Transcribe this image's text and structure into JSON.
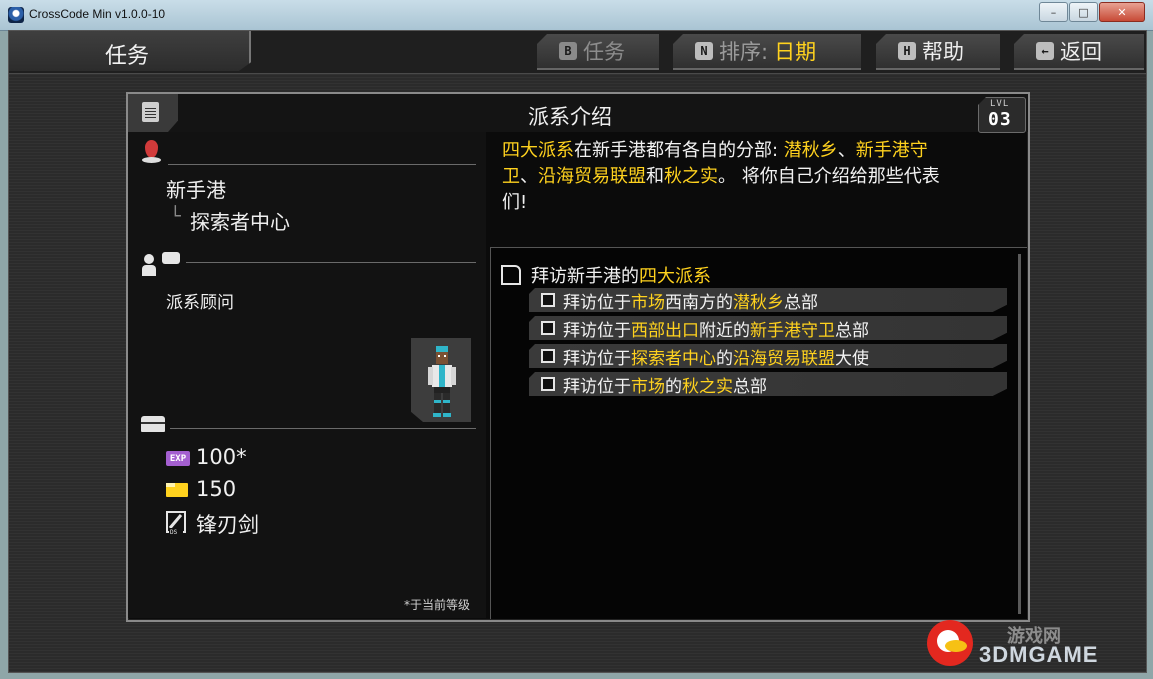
{
  "window": {
    "title": "CrossCode Min v1.0.0-10",
    "minimize": "–",
    "maximize": "□",
    "close": "✕"
  },
  "topbar": {
    "screen_title": "任务",
    "buttons": {
      "quests": {
        "key": "B",
        "label": "任务"
      },
      "sort": {
        "key": "N",
        "label": "排序:",
        "value": "日期"
      },
      "help": {
        "key": "H",
        "label": "帮助"
      },
      "back": {
        "key": "←",
        "label": "返回"
      }
    }
  },
  "quest": {
    "title": "派系介绍",
    "level_label": "LVL",
    "level": "03",
    "location": "新手港",
    "sub_location": "探索者中心",
    "sub_location_prefix": "└",
    "quest_giver": "派系顾问",
    "rewards": {
      "exp_icon_text": "EXP",
      "exp": "100*",
      "credits": "150",
      "item": "锋刃剑"
    },
    "footnote": "*于当前等级",
    "description": {
      "line1_a": "四大派系",
      "line1_b": "在新手港都有各自的分部: ",
      "line1_c": "潜秋乡",
      "line1_d": "、",
      "line1_e": "新手港守",
      "line2_a": "卫",
      "line2_b": "、",
      "line2_c": "沿海贸易联盟",
      "line2_d": "和",
      "line2_e": "秋之实",
      "line2_f": "。 将你自己介绍给那些代表",
      "line3": "们!"
    },
    "main_task": {
      "a": "拜访新手港的",
      "b": "四大派系"
    },
    "sub_tasks": [
      {
        "a": "拜访位于",
        "b": "市场",
        "c": "西南方的",
        "d": "潜秋乡",
        "e": "总部"
      },
      {
        "a": "拜访位于",
        "b": "西部出口",
        "c": "附近的",
        "d": "新手港守卫",
        "e": "总部"
      },
      {
        "a": "拜访位于",
        "b": "探索者中心",
        "c": "的",
        "d": "沿海贸易联盟",
        "e": "大使"
      },
      {
        "a": "拜访位于",
        "b": "市场",
        "c": "的",
        "d": "秋之实",
        "e": "总部"
      }
    ]
  },
  "watermark": {
    "cn": "游戏网",
    "en": "3DMGAME"
  },
  "colors": {
    "highlight": "#ffd21e",
    "panel_bg": "#0b0b0b",
    "text": "#f2f2f2"
  }
}
